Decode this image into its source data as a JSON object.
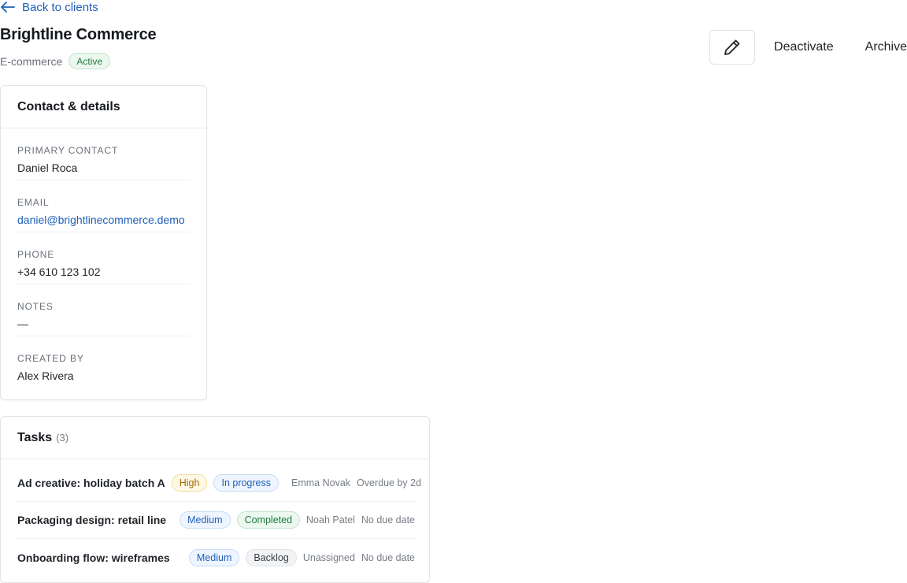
{
  "nav": {
    "back_label": "Back to clients"
  },
  "client": {
    "name": "Brightline Commerce",
    "category": "E-commerce",
    "status": "Active"
  },
  "actions": {
    "edit_icon": "pencil-icon",
    "deactivate_label": "Deactivate",
    "archive_label": "Archive"
  },
  "details": {
    "title": "Contact & details",
    "fields": [
      {
        "label": "Primary contact",
        "value": "Daniel Roca"
      },
      {
        "label": "Email",
        "value": "daniel@brightlinecommerce.demo"
      },
      {
        "label": "Phone",
        "value": "+34 610 123 102"
      },
      {
        "label": "Notes",
        "value": "—"
      },
      {
        "label": "Created by",
        "value": "Alex Rivera"
      }
    ]
  },
  "tasks": {
    "title": "Tasks",
    "count": "(3)",
    "items": [
      {
        "title": "Ad creative: holiday batch A",
        "priority": "High",
        "status": "In progress",
        "assignee": "Emma Novak",
        "due": "Overdue by 2d"
      },
      {
        "title": "Packaging design: retail line",
        "priority": "Medium",
        "status": "Completed",
        "assignee": "Noah Patel",
        "due": "No due date"
      },
      {
        "title": "Onboarding flow: wireframes",
        "priority": "Medium",
        "status": "Backlog",
        "assignee": "Unassigned",
        "due": "No due date"
      }
    ]
  },
  "colors": {
    "link": "#1f5fb8",
    "active_badge": "#1e7a3c",
    "high_priority": "#a06a00",
    "medium_priority": "#1f5fb8"
  }
}
